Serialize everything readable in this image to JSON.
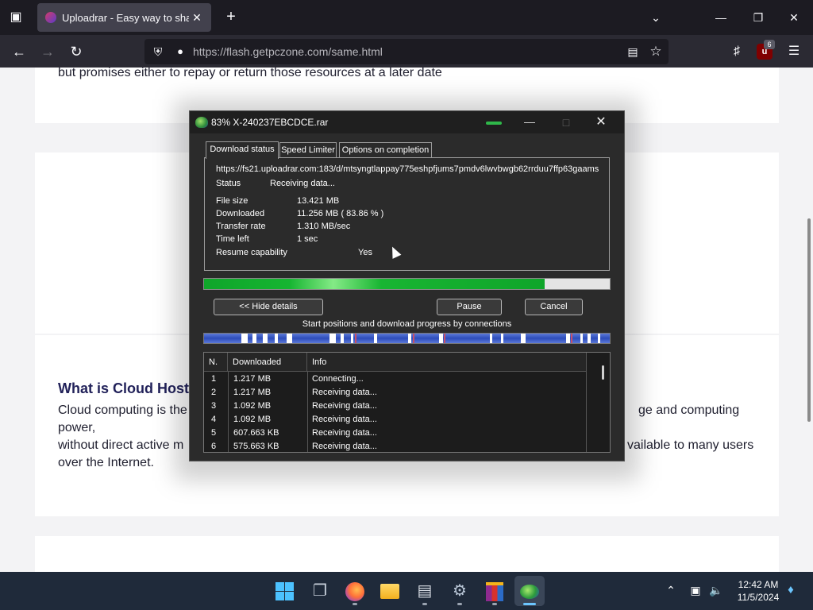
{
  "browser": {
    "tab_title": "Uploadrar - Easy way to share y",
    "url": "https://flash.getpczone.com/same.html",
    "ublock_badge": "6",
    "icons": {
      "tab_list": "tab-list-icon",
      "tab_favicon": "uploadrar-favicon",
      "tab_close": "close-icon",
      "new_tab": "plus-icon",
      "list_all_tabs": "chevron-down-icon",
      "minimize": "minimize-icon",
      "maximize": "restore-icon",
      "close": "close-icon",
      "back": "back-arrow-icon",
      "forward": "forward-arrow-icon",
      "reload": "reload-icon",
      "shield": "tracking-protection-icon",
      "lock": "lock-icon",
      "reader": "reader-view-icon",
      "bookmark": "star-icon",
      "extensions": "puzzle-icon",
      "ublock": "ublock-icon",
      "menu": "hamburger-menu-icon"
    }
  },
  "page": {
    "top_text": "but promises either to repay or return those resources at a later date",
    "heading": "What is Cloud Host",
    "para_line1_left": "Cloud computing is the",
    "para_line1_right": "ge and computing",
    "para_line2": "power,",
    "para_line3_left": "without direct active m",
    "para_line3_right": "vailable to many users",
    "para_line4": "over the Internet."
  },
  "dialog": {
    "title": "83% X-240237EBCDCE.rar",
    "tabs": [
      "Download status",
      "Speed Limiter",
      "Options on completion"
    ],
    "url": "https://fs21.uploadrar.com:183/d/mtsyngtlappay775eshpfjums7pmdv6lwvbwgb62rrduu7ffp63gaams",
    "status_label": "Status",
    "status_value": "Receiving data...",
    "file_size_label": "File size",
    "file_size_value": "13.421  MB",
    "downloaded_label": "Downloaded",
    "downloaded_value": "11.256  MB  ( 83.86 % )",
    "transfer_rate_label": "Transfer rate",
    "transfer_rate_value": "1.310  MB/sec",
    "time_left_label": "Time left",
    "time_left_value": "1 sec",
    "resume_label": "Resume capability",
    "resume_value": "Yes",
    "progress_fraction": 0.8386,
    "hide_details_label": "<< Hide details",
    "pause_label": "Pause",
    "cancel_label": "Cancel",
    "connections_caption": "Start positions and download progress by connections",
    "columns": [
      "N.",
      "Downloaded",
      "Info"
    ],
    "connections": [
      {
        "n": "1",
        "downloaded": "1.217  MB",
        "info": "Connecting..."
      },
      {
        "n": "2",
        "downloaded": "1.217  MB",
        "info": "Receiving data..."
      },
      {
        "n": "3",
        "downloaded": "1.092  MB",
        "info": "Receiving data..."
      },
      {
        "n": "4",
        "downloaded": "1.092  MB",
        "info": "Receiving data..."
      },
      {
        "n": "5",
        "downloaded": "607.663  KB",
        "info": "Receiving data..."
      },
      {
        "n": "6",
        "downloaded": "575.663  KB",
        "info": "Receiving data..."
      }
    ]
  },
  "taskbar": {
    "apps": [
      "windows-start-icon",
      "task-view-icon",
      "firefox-icon",
      "file-explorer-icon",
      "app-icon",
      "settings-icon",
      "winrar-icon",
      "internet-download-manager-icon"
    ],
    "time": "12:42 AM",
    "date": "11/5/2024"
  },
  "colors": {
    "browser_tabbar": "#1c1b22",
    "browser_navbar": "#2b2a33",
    "dialog_bg": "#2b2b2b",
    "progress_green": "#16b531",
    "heading_navy": "#22225a",
    "taskbar": "#1f2a3a"
  }
}
